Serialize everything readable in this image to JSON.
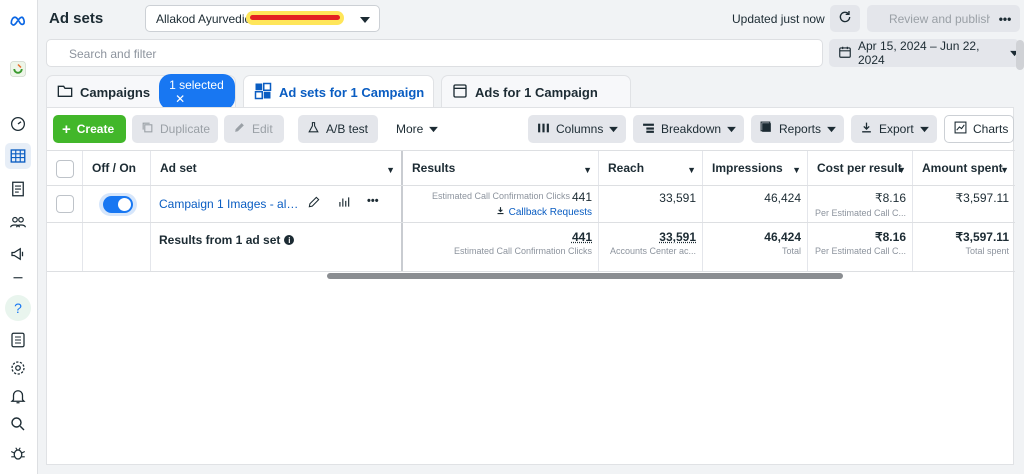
{
  "header": {
    "title": "Ad sets",
    "account_name": "Allakod Ayurvedic",
    "updated_text": "Updated just now",
    "review_button": "Review and publish",
    "more_button": "•••"
  },
  "search": {
    "placeholder": "Search and filter"
  },
  "date_range": "Apr 15, 2024 – Jun 22, 2024",
  "tabs": {
    "campaigns": "Campaigns",
    "selected_pill": "1 selected",
    "ad_sets": "Ad sets for 1 Campaign",
    "ads": "Ads for 1 Campaign"
  },
  "toolbar": {
    "create": "Create",
    "duplicate": "Duplicate",
    "edit": "Edit",
    "ab_test": "A/B test",
    "more": "More",
    "columns": "Columns",
    "breakdown": "Breakdown",
    "reports": "Reports",
    "export": "Export",
    "charts": "Charts"
  },
  "table": {
    "headers": {
      "toggle": "Off / On",
      "ad_set": "Ad set",
      "results": "Results",
      "reach": "Reach",
      "impressions": "Impressions",
      "cost_per_result": "Cost per result",
      "amount_spent": "Amount spent"
    },
    "row": {
      "ad_set_name": "Campaign 1 Images - allakod",
      "results_sub": "Estimated Call Confirmation Clicks",
      "results_value": "441",
      "callback": "Callback Requests",
      "reach": "33,591",
      "impressions": "46,424",
      "cost_per_result": "₹8.16",
      "cost_sub": "Per Estimated Call C...",
      "amount_spent": "₹3,597.11"
    },
    "totals": {
      "label": "Results from 1 ad set",
      "results_value": "441",
      "results_sub": "Estimated Call Confirmation Clicks",
      "reach": "33,591",
      "reach_sub": "Accounts Center ac...",
      "impressions": "46,424",
      "impressions_sub": "Total",
      "cost_per_result": "₹8.16",
      "cost_sub": "Per Estimated Call C...",
      "amount_spent": "₹3,597.11",
      "amount_sub": "Total spent"
    }
  },
  "colors": {
    "accent": "#1877f2",
    "create_green": "#42b72a",
    "link": "#0a5dc2"
  }
}
